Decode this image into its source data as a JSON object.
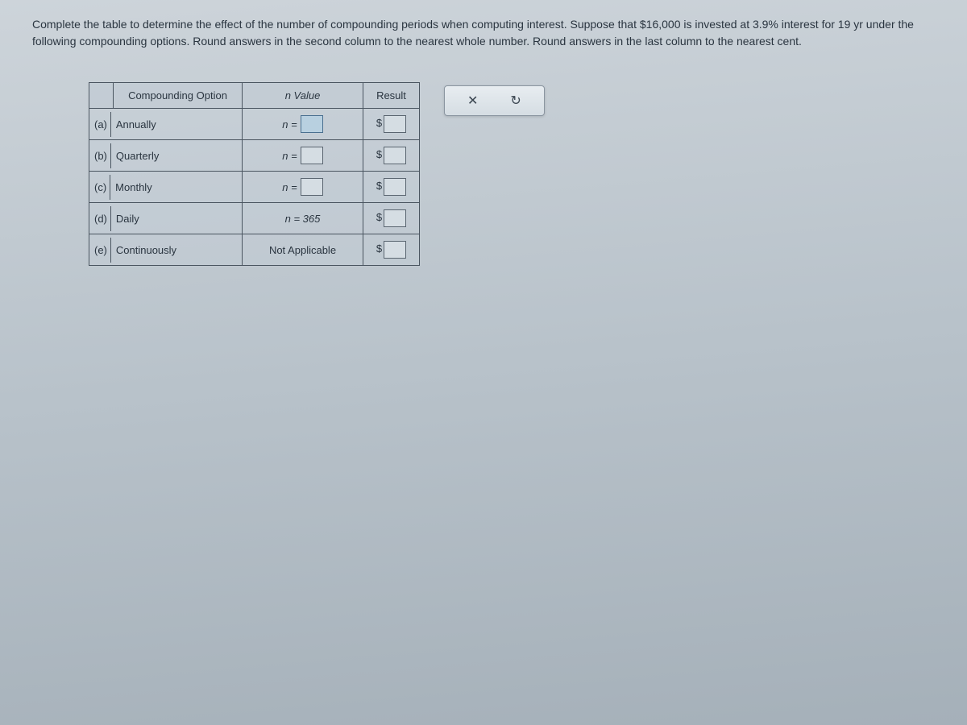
{
  "instructions": "Complete the table to determine the effect of the number of compounding periods when computing interest. Suppose that $16,000 is invested at 3.9% interest for 19 yr under the following compounding options. Round answers in the second column to the nearest whole number. Round answers in the last column to the nearest cent.",
  "table": {
    "headers": {
      "compounding": "Compounding Option",
      "nvalue": "n Value",
      "result": "Result"
    },
    "rows": [
      {
        "letter": "(a)",
        "option": "Annually",
        "nvalue_type": "input",
        "nvalue_text": "n =",
        "result_prefix": "$"
      },
      {
        "letter": "(b)",
        "option": "Quarterly",
        "nvalue_type": "input",
        "nvalue_text": "n =",
        "result_prefix": "$"
      },
      {
        "letter": "(c)",
        "option": "Monthly",
        "nvalue_type": "input",
        "nvalue_text": "n =",
        "result_prefix": "$"
      },
      {
        "letter": "(d)",
        "option": "Daily",
        "nvalue_type": "fixed",
        "nvalue_text": "n = 365",
        "result_prefix": "$"
      },
      {
        "letter": "(e)",
        "option": "Continuously",
        "nvalue_type": "na",
        "nvalue_text": "Not Applicable",
        "result_prefix": "$"
      }
    ]
  },
  "toolbar": {
    "close": "✕",
    "reset": "↻"
  }
}
